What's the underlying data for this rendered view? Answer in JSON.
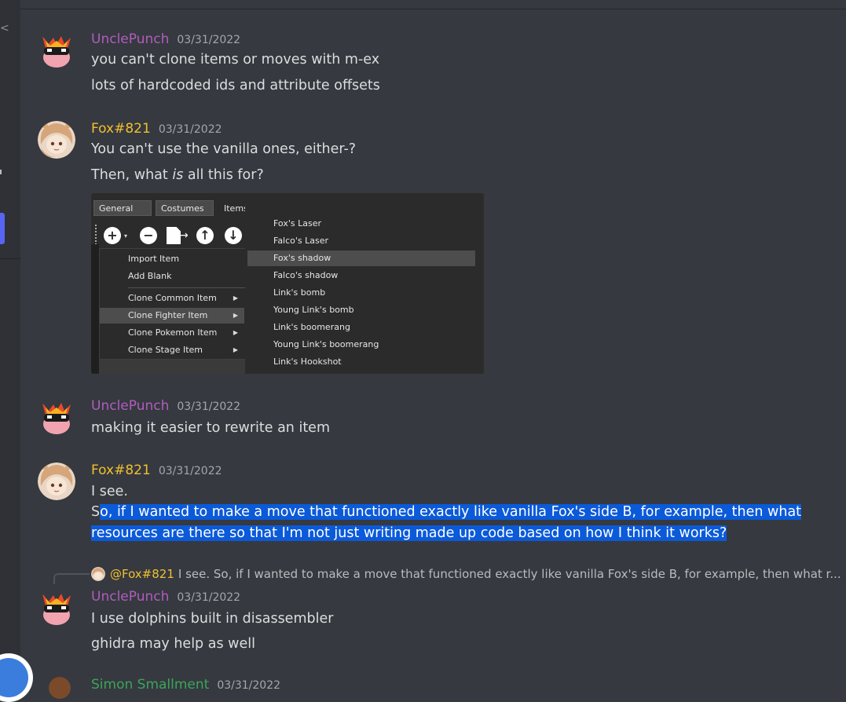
{
  "channel": {
    "left_glyph": "<"
  },
  "messages": [
    {
      "author": "UnclePunch",
      "timestamp": "03/31/2022",
      "lines": [
        "you can't clone items or moves with m-ex",
        "lots of hardcoded ids and attribute offsets"
      ]
    },
    {
      "author": "Fox#821",
      "timestamp": "03/31/2022",
      "lines": [
        "You can't use the vanilla ones, either-?"
      ],
      "line2_pre": "Then, what ",
      "line2_em": "is",
      "line2_post": " all this for?",
      "embed": {
        "tabs": [
          "General",
          "Costumes",
          "Items"
        ],
        "toolbar_icons": [
          "add-icon",
          "remove-icon",
          "export-icon",
          "move-up-icon",
          "move-down-icon"
        ],
        "menu_items": [
          "Import Item",
          "Add Blank",
          "Clone Common Item",
          "Clone Fighter Item",
          "Clone Pokemon Item",
          "Clone Stage Item"
        ],
        "submenu_items": [
          "Fox's Laser",
          "Falco's Laser",
          "Fox's shadow",
          "Falco's shadow",
          "Link's bomb",
          "Young Link's bomb",
          "Link's boomerang",
          "Young Link's boomerang",
          "Link's Hookshot"
        ]
      }
    },
    {
      "author": "UnclePunch",
      "timestamp": "03/31/2022",
      "lines": [
        "making it easier to rewrite an item"
      ]
    },
    {
      "author": "Fox#821",
      "timestamp": "03/31/2022",
      "lines": [
        "I see."
      ],
      "sel_first_char": "S",
      "sel_line1": "o, if I wanted to make a move that functioned exactly like vanilla Fox's side B, for example, then what ",
      "sel_line2": "resources are there so that I'm not just writing made up code based on how I think it works?"
    },
    {
      "reply": {
        "mention": "@Fox#821",
        "preview": "I see.  So, if I wanted to make a move that functioned exactly like vanilla Fox's side B, for example, then what r..."
      },
      "author": "UnclePunch",
      "timestamp": "03/31/2022",
      "lines": [
        "I use dolphins built in disassembler",
        "ghidra may help as well"
      ]
    },
    {
      "author": "Simon Smallment",
      "timestamp": "03/31/2022"
    }
  ],
  "colors": {
    "background": "#36393f",
    "unclepunch_name": "#b05dbd",
    "fox_name": "#f0c030",
    "selection": "#0b5ad9"
  }
}
